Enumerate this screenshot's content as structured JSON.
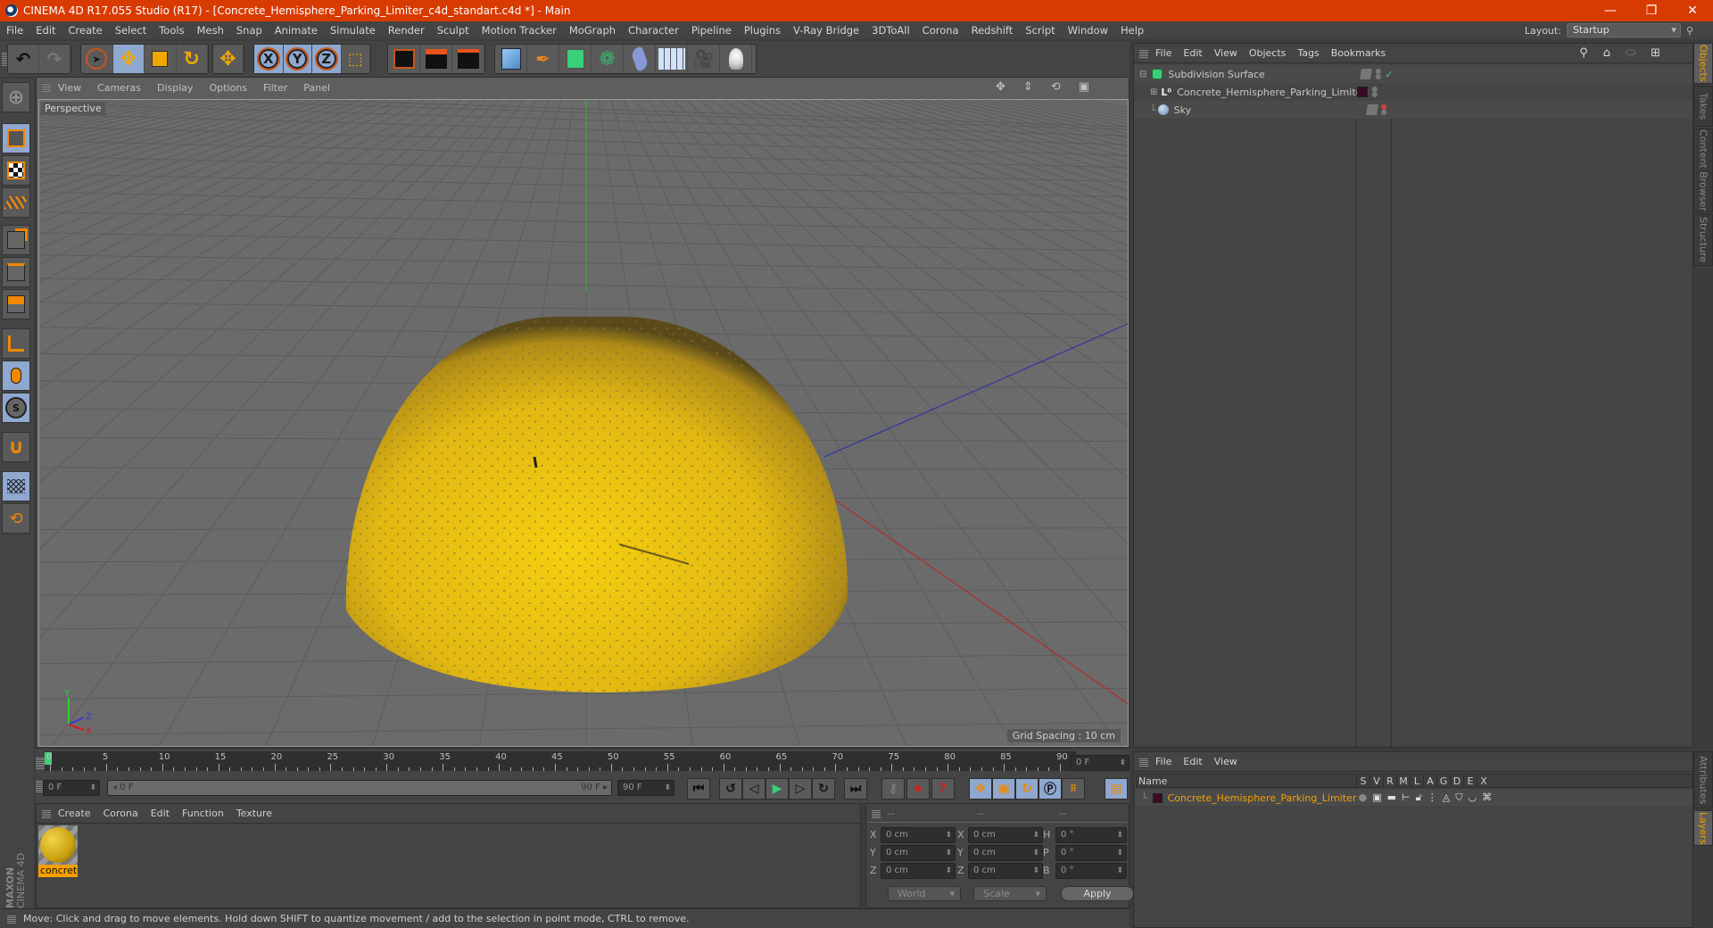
{
  "window": {
    "title": "CINEMA 4D R17.055 Studio (R17) - [Concrete_Hemisphere_Parking_Limiter_c4d_standart.c4d *] - Main",
    "controls": {
      "minimize": "—",
      "restore": "❐",
      "close": "✕"
    }
  },
  "menubar": [
    "File",
    "Edit",
    "Create",
    "Select",
    "Tools",
    "Mesh",
    "Snap",
    "Animate",
    "Simulate",
    "Render",
    "Sculpt",
    "Motion Tracker",
    "MoGraph",
    "Character",
    "Pipeline",
    "Plugins",
    "V-Ray Bridge",
    "3DToAll",
    "Corona",
    "Redshift",
    "Script",
    "Window",
    "Help"
  ],
  "layout": {
    "label": "Layout:",
    "value": "Startup"
  },
  "toolbar": {
    "undo": "undo-icon",
    "redo": "redo-icon",
    "tools": [
      "live-selection",
      "move",
      "scale",
      "rotate",
      "transform"
    ],
    "axes": [
      "X",
      "Y",
      "Z"
    ],
    "coord_system": "world-coordinates",
    "render": [
      "render-view",
      "render-to-picture-viewer",
      "render-settings"
    ],
    "objects": [
      "cube",
      "pen-spline",
      "subdivision-surface",
      "cloner",
      "deformer",
      "floor",
      "camera",
      "light"
    ]
  },
  "left_tools": [
    "make-editable",
    "model-mode",
    "texture-mode",
    "workplane-mode",
    "points-mode",
    "edges-mode",
    "polygons-mode",
    "axis-mode",
    "tweak-mode",
    "snap",
    "magnet",
    "lock-workplane",
    "planar-workplane"
  ],
  "viewport": {
    "menu": [
      "View",
      "Cameras",
      "Display",
      "Options",
      "Filter",
      "Panel"
    ],
    "camera_label": "Perspective",
    "grid_spacing": "Grid Spacing : 10 cm",
    "axis_labels": {
      "y": "Y",
      "z": "Z",
      "x": "X"
    },
    "colors": {
      "object": "#e8c10f",
      "grid_bg": "#6b6b6b",
      "y_axis": "#2fb52f",
      "x_axis": "#c02020",
      "z_axis": "#2a2ab0"
    }
  },
  "timeline": {
    "ticks": [
      "0",
      "5",
      "10",
      "15",
      "20",
      "25",
      "30",
      "35",
      "40",
      "45",
      "50",
      "55",
      "60",
      "65",
      "70",
      "75",
      "80",
      "85",
      "90"
    ],
    "current_frame": "0 F",
    "start_field": "0 F",
    "range_start": "0 F",
    "range_end": "90 F",
    "end_field": "90 F"
  },
  "material_panel": {
    "menu": [
      "Create",
      "Corona",
      "Edit",
      "Function",
      "Texture"
    ],
    "materials": [
      {
        "name": "concrete"
      }
    ],
    "brand": {
      "maxon": "MAXON",
      "product": "CINEMA 4D"
    }
  },
  "coordinates": {
    "headers": [
      "--",
      "--",
      "--"
    ],
    "rows": [
      {
        "l1": "X",
        "v1": "0 cm",
        "l2": "X",
        "v2": "0 cm",
        "l3": "H",
        "v3": "0 °"
      },
      {
        "l1": "Y",
        "v1": "0 cm",
        "l2": "Y",
        "v2": "0 cm",
        "l3": "P",
        "v3": "0 °"
      },
      {
        "l1": "Z",
        "v1": "0 cm",
        "l2": "Z",
        "v2": "0 cm",
        "l3": "B",
        "v3": "0 °"
      }
    ],
    "mode": "World",
    "transform": "Scale",
    "apply": "Apply"
  },
  "status": "Move: Click and drag to move elements. Hold down SHIFT to quantize movement / add to the selection in point mode, CTRL to remove.",
  "objects_panel": {
    "menu": [
      "File",
      "Edit",
      "View",
      "Objects",
      "Tags",
      "Bookmarks"
    ],
    "items": [
      {
        "name": "Subdivision Surface",
        "icon": "subdivision-surface-icon"
      },
      {
        "name": "Concrete_Hemisphere_Parking_Limiter",
        "icon": "null-object-icon"
      },
      {
        "name": "Sky",
        "icon": "sky-icon"
      }
    ]
  },
  "layers_panel": {
    "menu": [
      "File",
      "Edit",
      "View"
    ],
    "header": {
      "name": "Name",
      "cols": [
        "S",
        "V",
        "R",
        "M",
        "L",
        "A",
        "G",
        "D",
        "E",
        "X"
      ]
    },
    "rows": [
      {
        "name": "Concrete_Hemisphere_Parking_Limiter",
        "color": "#3a0a26"
      }
    ]
  },
  "side_tabs_top": [
    "Objects",
    "Takes",
    "Content Browser",
    "Structure"
  ],
  "side_tabs_bottom": [
    "Attributes",
    "Layers"
  ]
}
